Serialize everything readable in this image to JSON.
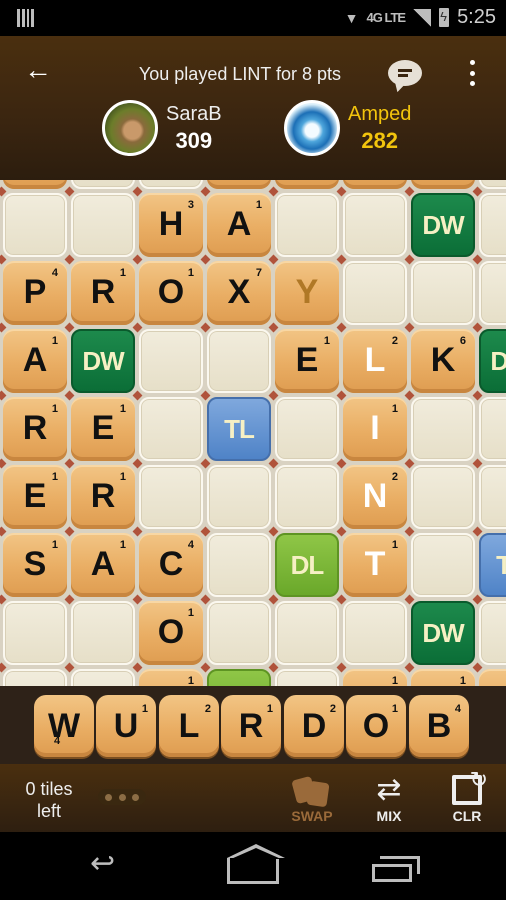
{
  "status_bar": {
    "network": "4G LTE",
    "time": "5:25"
  },
  "header": {
    "title": "You played LINT for 8 pts",
    "players": [
      {
        "name": "SaraB",
        "score": "309",
        "avatar": "chick-photo"
      },
      {
        "name": "Amped",
        "score": "282",
        "avatar": "water-wave",
        "active": true
      }
    ]
  },
  "board": {
    "visible_columns": 8,
    "rows": [
      [
        {
          "t": "tile"
        },
        {
          "t": "empty"
        },
        {
          "t": "empty"
        },
        {
          "t": "tile"
        },
        {
          "t": "tile"
        },
        {
          "t": "tile"
        },
        {
          "t": "tile"
        },
        {
          "t": "empty"
        }
      ],
      [
        {
          "t": "empty"
        },
        {
          "t": "empty"
        },
        {
          "t": "tile",
          "l": "H",
          "p": "3"
        },
        {
          "t": "tile",
          "l": "A",
          "p": "1"
        },
        {
          "t": "empty"
        },
        {
          "t": "empty"
        },
        {
          "t": "bonus",
          "b": "DW"
        },
        {
          "t": "empty"
        }
      ],
      [
        {
          "t": "tile",
          "l": "P",
          "p": "4"
        },
        {
          "t": "tile",
          "l": "R",
          "p": "1"
        },
        {
          "t": "tile",
          "l": "O",
          "p": "1"
        },
        {
          "t": "tile",
          "l": "X",
          "p": "7"
        },
        {
          "t": "tile",
          "l": "Y",
          "p": "",
          "ghost": true
        },
        {
          "t": "empty"
        },
        {
          "t": "empty"
        },
        {
          "t": "empty"
        }
      ],
      [
        {
          "t": "tile",
          "l": "A",
          "p": "1"
        },
        {
          "t": "bonus",
          "b": "DW"
        },
        {
          "t": "empty"
        },
        {
          "t": "empty"
        },
        {
          "t": "tile",
          "l": "E",
          "p": "1"
        },
        {
          "t": "tile",
          "l": "L",
          "p": "2",
          "recent": true
        },
        {
          "t": "tile",
          "l": "K",
          "p": "6"
        },
        {
          "t": "bonus",
          "b": "DW"
        }
      ],
      [
        {
          "t": "tile",
          "l": "R",
          "p": "1"
        },
        {
          "t": "tile",
          "l": "E",
          "p": "1"
        },
        {
          "t": "empty"
        },
        {
          "t": "bonus",
          "b": "TL"
        },
        {
          "t": "empty"
        },
        {
          "t": "tile",
          "l": "I",
          "p": "1",
          "recent": true
        },
        {
          "t": "empty"
        },
        {
          "t": "empty"
        }
      ],
      [
        {
          "t": "tile",
          "l": "E",
          "p": "1"
        },
        {
          "t": "tile",
          "l": "R",
          "p": "1"
        },
        {
          "t": "empty"
        },
        {
          "t": "empty"
        },
        {
          "t": "empty"
        },
        {
          "t": "tile",
          "l": "N",
          "p": "2",
          "recent": true
        },
        {
          "t": "empty"
        },
        {
          "t": "empty"
        }
      ],
      [
        {
          "t": "tile",
          "l": "S",
          "p": "1"
        },
        {
          "t": "tile",
          "l": "A",
          "p": "1"
        },
        {
          "t": "tile",
          "l": "C",
          "p": "4"
        },
        {
          "t": "empty"
        },
        {
          "t": "bonus",
          "b": "DL"
        },
        {
          "t": "tile",
          "l": "T",
          "p": "1",
          "recent": true
        },
        {
          "t": "empty"
        },
        {
          "t": "bonus",
          "b": "TL"
        }
      ],
      [
        {
          "t": "empty"
        },
        {
          "t": "empty"
        },
        {
          "t": "tile",
          "l": "O",
          "p": "1"
        },
        {
          "t": "empty"
        },
        {
          "t": "empty"
        },
        {
          "t": "empty"
        },
        {
          "t": "bonus",
          "b": "DW"
        },
        {
          "t": "empty"
        }
      ],
      [
        {
          "t": "empty"
        },
        {
          "t": "empty"
        },
        {
          "t": "tile",
          "l": "",
          "p": "1"
        },
        {
          "t": "bonus",
          "b": "DL"
        },
        {
          "t": "empty"
        },
        {
          "t": "tile",
          "l": "",
          "p": "1"
        },
        {
          "t": "tile",
          "l": "",
          "p": "1"
        },
        {
          "t": "tile"
        }
      ]
    ]
  },
  "rack": {
    "tiles": [
      {
        "l": "W",
        "p": "4"
      },
      {
        "l": "U",
        "p": "1"
      },
      {
        "l": "L",
        "p": "2"
      },
      {
        "l": "R",
        "p": "1"
      },
      {
        "l": "D",
        "p": "2"
      },
      {
        "l": "O",
        "p": "1"
      },
      {
        "l": "B",
        "p": "4"
      }
    ]
  },
  "footer": {
    "tiles_left_line1": "0 tiles",
    "tiles_left_line2": "left",
    "actions": {
      "swap": "SWAP",
      "mix": "MIX",
      "clr": "CLR"
    }
  },
  "colors": {
    "accent_score": "#f2c40d",
    "tile": "#e9ad63",
    "dw": "#0b6e37",
    "dl": "#6aa82a",
    "tl": "#4f83c7"
  }
}
